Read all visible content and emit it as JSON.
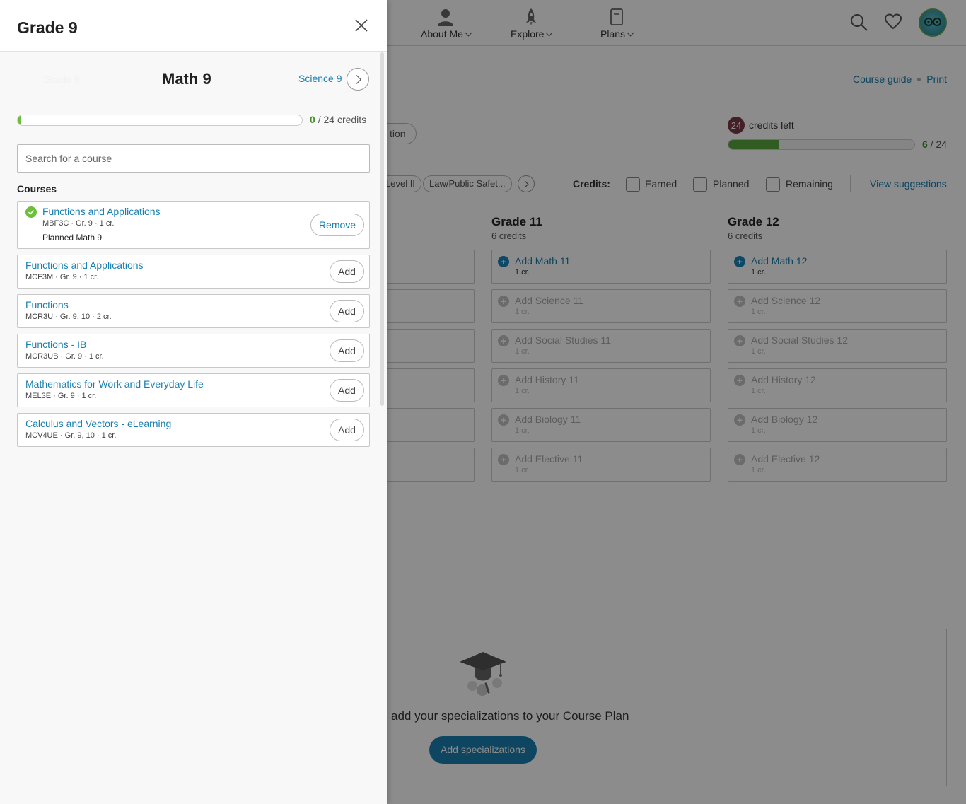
{
  "colors": {
    "accent": "#1a7fb0",
    "progress_green": "#6cbf3a",
    "credits_badge": "#7a3a4a",
    "overlay": "rgba(0,0,0,0.45)"
  },
  "background": {
    "nav": {
      "items": [
        {
          "label": "About Me",
          "icon": "person-icon"
        },
        {
          "label": "Explore",
          "icon": "rocket-icon"
        },
        {
          "label": "Plans",
          "icon": "clipboard-icon"
        }
      ],
      "icons": [
        "search-icon",
        "heart-icon",
        "avatar"
      ]
    },
    "links": {
      "course_guide": "Course guide",
      "print": "Print"
    },
    "pill_partial": "tion",
    "credits": {
      "left_count": "24",
      "left_label": "credits left",
      "earned": "6",
      "total": "24",
      "fraction": 0.27
    },
    "filters": {
      "tags": [
        "Level II",
        "Law/Public Safet..."
      ],
      "credits_label": "Credits:",
      "checkboxes": [
        "Earned",
        "Planned",
        "Remaining"
      ],
      "view_suggestions": "View suggestions"
    },
    "grades": [
      {
        "title": "Grade 11",
        "sub": "6 credits",
        "slots": [
          {
            "label": "Add Math 11",
            "credits": "1 cr.",
            "active": true
          },
          {
            "label": "Add Science 11",
            "credits": "1 cr.",
            "active": false
          },
          {
            "label": "Add Social Studies 11",
            "credits": "1 cr.",
            "active": false
          },
          {
            "label": "Add History 11",
            "credits": "1 cr.",
            "active": false
          },
          {
            "label": "Add Biology 11",
            "credits": "1 cr.",
            "active": false
          },
          {
            "label": "Add Elective 11",
            "credits": "1 cr.",
            "active": false
          }
        ]
      },
      {
        "title": "Grade 12",
        "sub": "6 credits",
        "slots": [
          {
            "label": "Add Math 12",
            "credits": "1 cr.",
            "active": true
          },
          {
            "label": "Add Science 12",
            "credits": "1 cr.",
            "active": false
          },
          {
            "label": "Add Social Studies 12",
            "credits": "1 cr.",
            "active": false
          },
          {
            "label": "Add History 12",
            "credits": "1 cr.",
            "active": false
          },
          {
            "label": "Add Biology 12",
            "credits": "1 cr.",
            "active": false
          },
          {
            "label": "Add Elective 12",
            "credits": "1 cr.",
            "active": false
          }
        ]
      }
    ],
    "specializations": {
      "text": "add your specializations to your Course Plan",
      "button": "Add specializations"
    }
  },
  "panel": {
    "title": "Grade 9",
    "prev_subject": "Grade 9",
    "subject": "Math 9",
    "next_subject": "Science 9",
    "progress": {
      "earned": "0",
      "separator": "/",
      "total": "24",
      "unit": "credits",
      "fraction": 0.01
    },
    "search_placeholder": "Search for a course",
    "courses_heading": "Courses",
    "courses": [
      {
        "name": "Functions and Applications",
        "meta": "MBF3C · Gr. 9 · 1 cr.",
        "selected": true,
        "planned": "Planned Math 9",
        "action": "Remove"
      },
      {
        "name": "Functions and Applications",
        "meta": "MCF3M · Gr. 9 · 1 cr.",
        "selected": false,
        "action": "Add"
      },
      {
        "name": "Functions",
        "meta": "MCR3U · Gr. 9, 10 · 2 cr.",
        "selected": false,
        "action": "Add"
      },
      {
        "name": "Functions - IB",
        "meta": "MCR3UB · Gr. 9 · 1 cr.",
        "selected": false,
        "action": "Add"
      },
      {
        "name": "Mathematics for Work and Everyday Life",
        "meta": "MEL3E · Gr. 9 · 1 cr.",
        "selected": false,
        "action": "Add"
      },
      {
        "name": "Calculus and Vectors - eLearning",
        "meta": "MCV4UE · Gr. 9, 10 · 1 cr.",
        "selected": false,
        "action": "Add"
      }
    ]
  }
}
